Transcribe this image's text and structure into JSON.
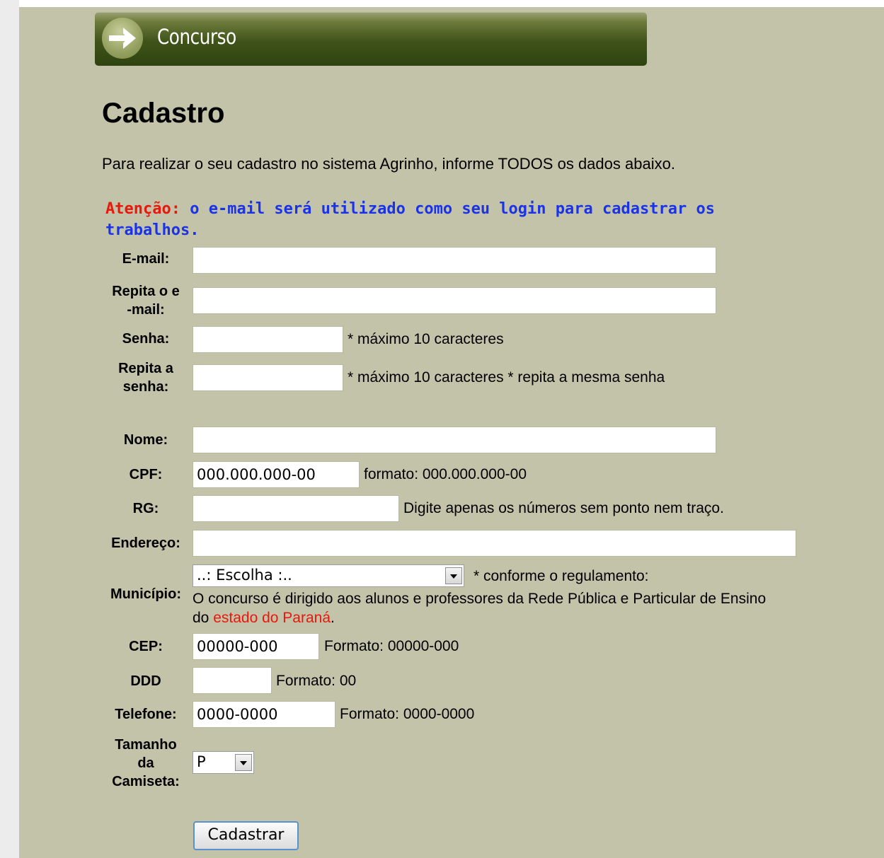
{
  "header": {
    "title": "Concurso",
    "icon": "arrow-right-icon"
  },
  "page": {
    "title": "Cadastro",
    "intro": "Para realizar o seu cadastro no sistema Agrinho, informe TODOS os dados abaixo.",
    "attention_label": "Atenção:",
    "attention_text": " o e-mail será utilizado como seu login para cadastrar os trabalhos."
  },
  "form": {
    "email": {
      "label": "E-mail:",
      "value": ""
    },
    "email_repeat": {
      "label_line1": "Repita o e",
      "label_line2": "-mail:",
      "value": ""
    },
    "password": {
      "label": "Senha:",
      "value": "",
      "note": "* máximo 10 caracteres"
    },
    "password_repeat": {
      "label_line1": "Repita a",
      "label_line2": "senha:",
      "value": "",
      "note": "* máximo 10 caracteres * repita a mesma senha"
    },
    "name": {
      "label": "Nome:",
      "value": ""
    },
    "cpf": {
      "label": "CPF:",
      "value": "000.000.000-00",
      "note": "formato: 000.000.000-00"
    },
    "rg": {
      "label": "RG:",
      "value": "",
      "note": "Digite apenas os números sem ponto nem traço."
    },
    "address": {
      "label": "Endereço:",
      "value": ""
    },
    "municipio": {
      "label": "Município:",
      "selected": "..: Escolha :..",
      "note": "* conforme o regulamento:",
      "info_text": "O concurso é dirigido aos alunos e professores da Rede Pública e Particular de Ensino do ",
      "info_highlight": "estado do Paraná",
      "info_end": "."
    },
    "cep": {
      "label": "CEP:",
      "value": "00000-000",
      "note": "Formato: 00000-000"
    },
    "ddd": {
      "label": "DDD",
      "value": "",
      "note": "Formato: 00"
    },
    "phone": {
      "label": "Telefone:",
      "value": "0000-0000",
      "note": "Formato: 0000-0000"
    },
    "shirt_size": {
      "label_line1": "Tamanho",
      "label_line2": "da",
      "label_line3": "Camiseta:",
      "selected": "P"
    },
    "submit_label": "Cadastrar"
  },
  "colors": {
    "background": "#c3c3aa",
    "header": "#3f5319",
    "warning": "#e8180c",
    "attention": "#1a33e8"
  }
}
